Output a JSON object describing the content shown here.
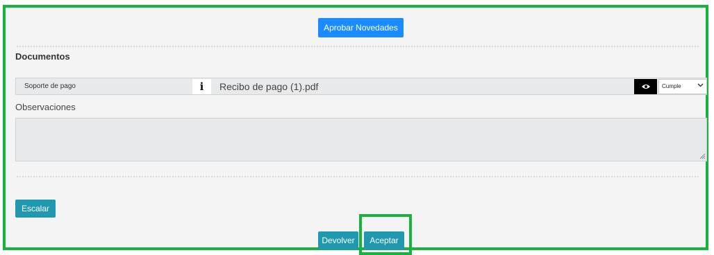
{
  "actions": {
    "approve_label": "Aprobar Novedades",
    "escalate_label": "Escalar",
    "return_label": "Devolver",
    "accept_label": "Aceptar"
  },
  "documents": {
    "heading": "Documentos",
    "row": {
      "label": "Soporte de pago",
      "info_glyph": "i",
      "filename": "Recibo de pago (1).pdf",
      "status_value": "Cumple"
    }
  },
  "observations": {
    "label": "Observaciones",
    "value": ""
  },
  "colors": {
    "frame_highlight": "#17b33f",
    "primary_button": "#1a8cff",
    "teal_button": "#1f98b0"
  }
}
